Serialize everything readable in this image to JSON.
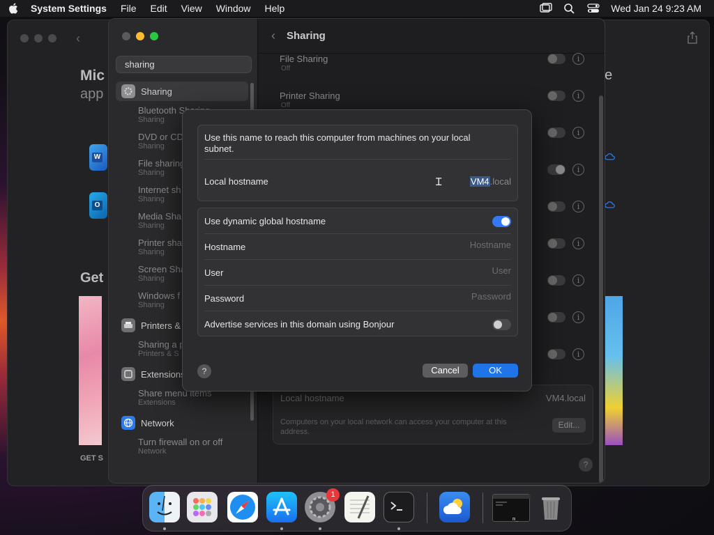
{
  "menubar": {
    "app": "System Settings",
    "items": [
      "File",
      "Edit",
      "View",
      "Window",
      "Help"
    ],
    "clock": "Wed Jan 24  9:23 AM"
  },
  "back_window": {
    "title_fragment": "Mic",
    "subtitle_fragment": "app",
    "get_fragment": "Get",
    "get_small": "GET S",
    "right_fragment": "ne"
  },
  "sidebar": {
    "search_value": "sharing",
    "items": [
      {
        "type": "section",
        "label": "Sharing",
        "color": "#8e8e93"
      },
      {
        "type": "sub",
        "title": "Bluetooth Sharing",
        "subtitle": "Sharing"
      },
      {
        "type": "sub",
        "title": "DVD or CD",
        "subtitle": "Sharing"
      },
      {
        "type": "sub",
        "title": "File sharing",
        "subtitle": "Sharing"
      },
      {
        "type": "sub",
        "title": "Internet sh",
        "subtitle": "Sharing"
      },
      {
        "type": "sub",
        "title": "Media Sha",
        "subtitle": "Sharing"
      },
      {
        "type": "sub",
        "title": "Printer sha",
        "subtitle": "Sharing"
      },
      {
        "type": "sub",
        "title": "Screen Sha",
        "subtitle": "Sharing"
      },
      {
        "type": "sub",
        "title": "Windows f",
        "subtitle": "Sharing"
      },
      {
        "type": "section",
        "label": "Printers &",
        "color": "#8e8e93"
      },
      {
        "type": "sub",
        "title": "Sharing a p",
        "subtitle": "Printers & S"
      },
      {
        "type": "section",
        "label": "Extensions",
        "color": "#8e8e93"
      },
      {
        "type": "sub",
        "title": "Share menu items",
        "subtitle": "Extensions"
      },
      {
        "type": "section",
        "label": "Network",
        "color": "#2f7be6"
      },
      {
        "type": "sub",
        "title": "Turn firewall on or off",
        "subtitle": "Network"
      }
    ]
  },
  "content": {
    "title": "Sharing",
    "file_sharing": {
      "label": "File Sharing",
      "status": "Off"
    },
    "printer_sharing": {
      "label": "Printer Sharing",
      "status": "Off"
    },
    "local_hostname_label": "Local hostname",
    "local_hostname_value": "VM4.local",
    "local_hostname_desc": "Computers on your local network can access your computer at this address.",
    "edit_button": "Edit...",
    "help": "?"
  },
  "dialog": {
    "description": "Use this name to reach this computer from machines on your local subnet.",
    "local_hostname_label": "Local hostname",
    "hostname_selected": "VM4",
    "hostname_suffix": ".local",
    "dynamic_label": "Use dynamic global hostname",
    "dynamic_on": true,
    "hostname_label": "Hostname",
    "hostname_placeholder": "Hostname",
    "user_label": "User",
    "user_placeholder": "User",
    "password_label": "Password",
    "password_placeholder": "Password",
    "bonjour_label": "Advertise services in this domain using Bonjour",
    "bonjour_on": false,
    "help": "?",
    "cancel": "Cancel",
    "ok": "OK"
  },
  "dock": {
    "items": [
      "finder-icon",
      "launchpad-icon",
      "safari-icon",
      "app-store-icon",
      "system-settings-icon",
      "textedit-icon",
      "terminal-icon",
      "weather-icon",
      "terminal-window-icon",
      "trash-icon"
    ],
    "badge": "1"
  },
  "colors": {
    "accent": "#1f74e8",
    "toggle_on": "#3478f6"
  }
}
